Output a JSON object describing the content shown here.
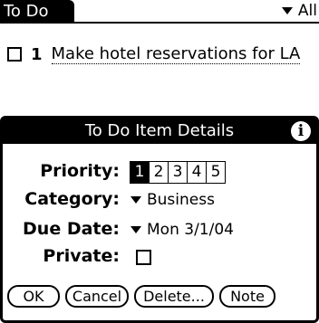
{
  "title_bar": {
    "title": "To Do",
    "category_picker": "All"
  },
  "list": [
    {
      "priority": "1",
      "description": "Make hotel reservations for LA",
      "checked": false
    }
  ],
  "dialog": {
    "title": "To Do Item Details",
    "priority_label": "Priority:",
    "priorities": [
      "1",
      "2",
      "3",
      "4",
      "5"
    ],
    "selected_priority": "1",
    "category_label": "Category:",
    "category_value": "Business",
    "due_date_label": "Due Date:",
    "due_date_value": "Mon 3/1/04",
    "private_label": "Private:",
    "private_checked": false,
    "buttons": {
      "ok": "OK",
      "cancel": "Cancel",
      "delete": "Delete...",
      "note": "Note"
    }
  }
}
